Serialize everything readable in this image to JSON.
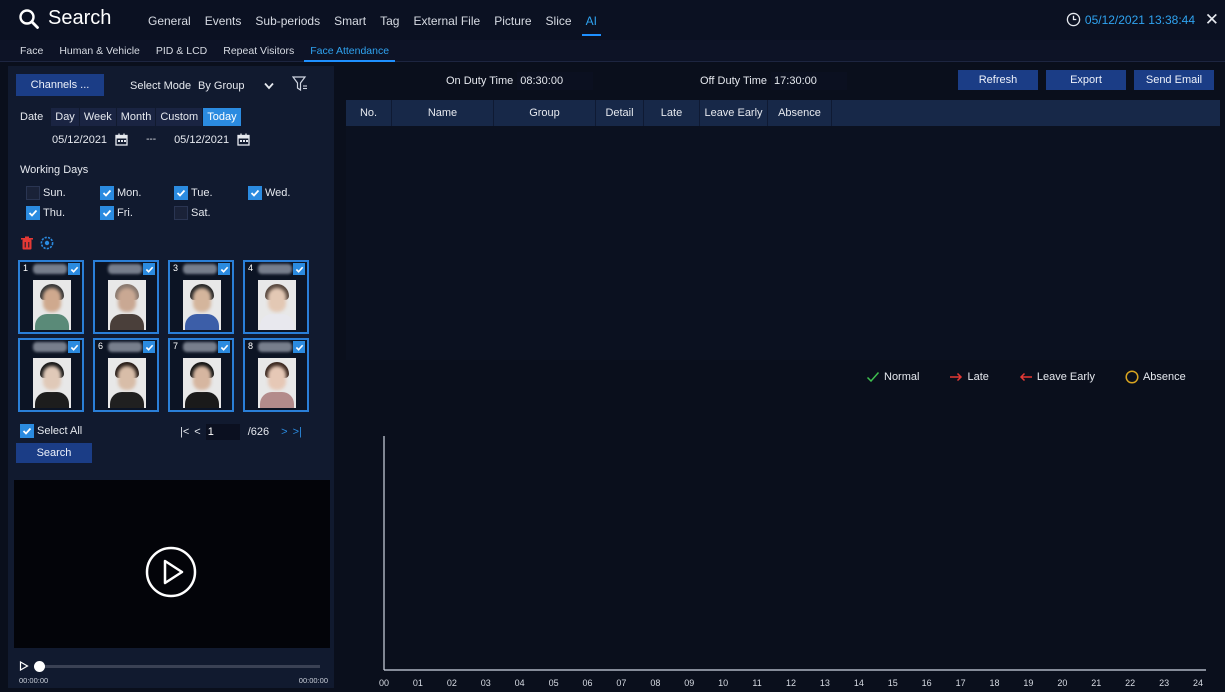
{
  "header": {
    "title": "Search",
    "tabs": [
      {
        "label": "General",
        "active": false
      },
      {
        "label": "Events",
        "active": false
      },
      {
        "label": "Sub-periods",
        "active": false
      },
      {
        "label": "Smart",
        "active": false
      },
      {
        "label": "Tag",
        "active": false
      },
      {
        "label": "External File",
        "active": false
      },
      {
        "label": "Picture",
        "active": false
      },
      {
        "label": "Slice",
        "active": false
      },
      {
        "label": "AI",
        "active": true
      }
    ],
    "datetime": "05/12/2021 13:38:44",
    "icons": {
      "search": "search-icon",
      "clock": "clock-icon",
      "close": "close-icon"
    }
  },
  "sub_tabs": [
    {
      "label": "Face",
      "active": false
    },
    {
      "label": "Human & Vehicle",
      "active": false
    },
    {
      "label": "PID & LCD",
      "active": false
    },
    {
      "label": "Repeat Visitors",
      "active": false
    },
    {
      "label": "Face Attendance",
      "active": true
    }
  ],
  "left": {
    "channels_label": "Channels ...",
    "select_mode_label": "Select Mode",
    "select_mode_value": "By Group",
    "date_label": "Date",
    "periods": [
      {
        "label": "Day",
        "active": false
      },
      {
        "label": "Week",
        "active": false
      },
      {
        "label": "Month",
        "active": false
      },
      {
        "label": "Custom",
        "active": false
      },
      {
        "label": "Today",
        "active": true
      }
    ],
    "start_date": "05/12/2021",
    "date_separator": "---",
    "end_date": "05/12/2021",
    "working_days_label": "Working Days",
    "working_days": [
      {
        "label": "Sun.",
        "checked": false
      },
      {
        "label": "Mon.",
        "checked": true
      },
      {
        "label": "Tue.",
        "checked": true
      },
      {
        "label": "Wed.",
        "checked": true
      },
      {
        "label": "Thu.",
        "checked": true
      },
      {
        "label": "Fri.",
        "checked": true
      },
      {
        "label": "Sat.",
        "checked": false
      }
    ],
    "faces": [
      {
        "num": "1",
        "checked": true
      },
      {
        "num": "",
        "checked": true
      },
      {
        "num": "3",
        "checked": true
      },
      {
        "num": "4",
        "checked": true
      },
      {
        "num": "",
        "checked": true
      },
      {
        "num": "6",
        "checked": true
      },
      {
        "num": "7",
        "checked": true
      },
      {
        "num": "8",
        "checked": true
      }
    ],
    "select_all_label": "Select All",
    "select_all_checked": true,
    "page_current": "1",
    "page_total": "/626",
    "search_label": "Search",
    "time_start": "00:00:00",
    "time_end": "00:00:00"
  },
  "right": {
    "on_duty_label": "On Duty Time",
    "on_duty_value": "08:30:00",
    "off_duty_label": "Off Duty Time",
    "off_duty_value": "17:30:00",
    "refresh_label": "Refresh",
    "export_label": "Export",
    "send_email_label": "Send Email",
    "columns": [
      "No.",
      "Name",
      "Group",
      "Detail",
      "Late",
      "Leave Early",
      "Absence"
    ],
    "rows": [],
    "legend": [
      {
        "label": "Normal",
        "icon": "check-icon",
        "color": "#3fbf4f"
      },
      {
        "label": "Late",
        "icon": "arrow-right-icon",
        "color": "#e53935"
      },
      {
        "label": "Leave Early",
        "icon": "arrow-left-icon",
        "color": "#e53935"
      },
      {
        "label": "Absence",
        "icon": "circle-icon",
        "color": "#d9a520"
      }
    ]
  },
  "chart_data": {
    "type": "bar",
    "categories": [
      "00",
      "01",
      "02",
      "03",
      "04",
      "05",
      "06",
      "07",
      "08",
      "09",
      "10",
      "11",
      "12",
      "13",
      "14",
      "15",
      "16",
      "17",
      "18",
      "19",
      "20",
      "21",
      "22",
      "23",
      "24"
    ],
    "series": [],
    "title": "",
    "xlabel": "",
    "ylabel": ""
  },
  "colors": {
    "accent": "#2fa3f0",
    "button": "#1b3d86",
    "active_period": "#2b8be0",
    "background": "#0a0f1c"
  }
}
